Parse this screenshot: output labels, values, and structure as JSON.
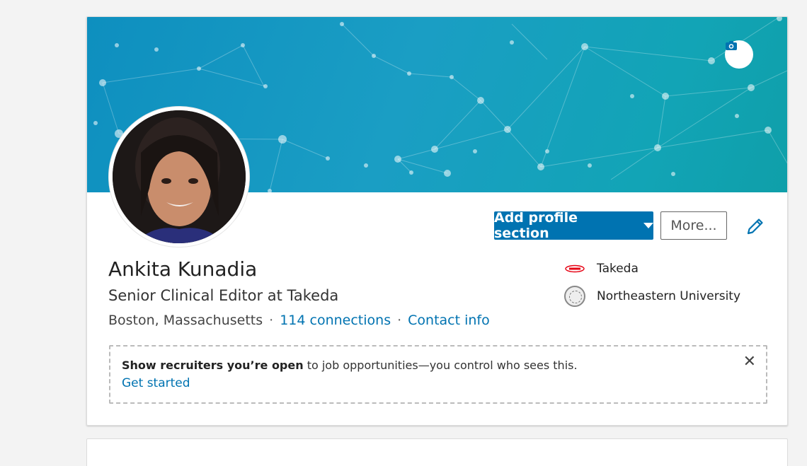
{
  "profile": {
    "name": "Ankita Kunadia",
    "headline": "Senior Clinical Editor at Takeda",
    "location": "Boston, Massachusetts",
    "separator": "·",
    "connections": "114 connections",
    "contact_info": "Contact info"
  },
  "actions": {
    "add_section_label": "Add profile section",
    "more_label": "More..."
  },
  "experience": {
    "company": "Takeda",
    "school": "Northeastern University"
  },
  "notice": {
    "bold_text": "Show recruiters you’re open",
    "rest_text": " to job opportunities—you control who sees this.",
    "cta": "Get started",
    "close_symbol": "✕"
  },
  "icons": {
    "camera": "camera-icon",
    "edit": "pencil-icon",
    "dropdown": "caret-down-icon",
    "close": "close-icon"
  },
  "colors": {
    "accent": "#0073b1",
    "banner": "#0e8fbf",
    "takeda_red": "#e60012"
  }
}
